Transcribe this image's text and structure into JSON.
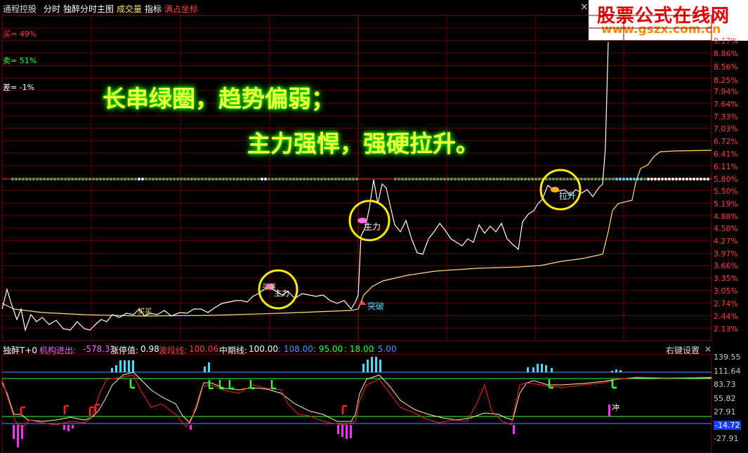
{
  "topbar": {
    "title": "通程控股",
    "tab_fenshi": "分时",
    "tab_main": "独醉分时主图",
    "tab_volume": "成交量",
    "tab_indicator": "指标",
    "tab_fullscale": "满占坐标",
    "close": "×"
  },
  "logo": {
    "line1": "股票公式在线网",
    "line2": "www.gszx.com.cn"
  },
  "panel_labels": {
    "sell1": "买= 49%",
    "sell2": "卖= 51%",
    "diff": "差= -1%"
  },
  "captions": {
    "line1": "长串绿圈，趋势偏弱；",
    "line2": "主力强悍，强硬拉升。"
  },
  "annotations": {
    "breakout": "突破",
    "main_force": "主力",
    "main_force_small": "主力",
    "lift": "拉升",
    "buy": "买买",
    "chong": "冲"
  },
  "price_axis": [
    "9.17%",
    "8.86%",
    "8.56%",
    "8.25%",
    "7.94%",
    "7.64%",
    "7.33%",
    "7.03%",
    "6.72%",
    "6.41%",
    "6.11%",
    "5.80%",
    "5.50%",
    "5.19%",
    "4.88%",
    "4.58%",
    "4.27%",
    "3.97%",
    "3.66%",
    "3.35%",
    "3.05%",
    "2.74%",
    "2.44%",
    "2.13%"
  ],
  "indicator_bar": {
    "name": "独醉T+0",
    "inst_label": "机构进出:",
    "inst_value": "-578.31",
    "limit_label": "涨停值:",
    "limit_value": "0.98",
    "wave_label": "波段线:",
    "wave_value": "100.06",
    "mid_label": "中期线:",
    "mid_value": "100.00",
    "v1": ": 108.00",
    "v2": ": 95.00",
    "v3": ": 18.00",
    "v4": ": 5.00",
    "settings": "右键设置",
    "close": "×"
  },
  "indicator_axis": [
    "139.55",
    "111.64",
    "83.73",
    "55.82",
    "27.91",
    "-14.72",
    "-27.91"
  ],
  "colors": {
    "grid": "#8a0000",
    "price": "#ffffff",
    "avg": "#ffe070",
    "green": "#00ff40",
    "cyan": "#4fd8ff",
    "magenta": "#ff30ff",
    "circle": "#ffee00"
  }
}
